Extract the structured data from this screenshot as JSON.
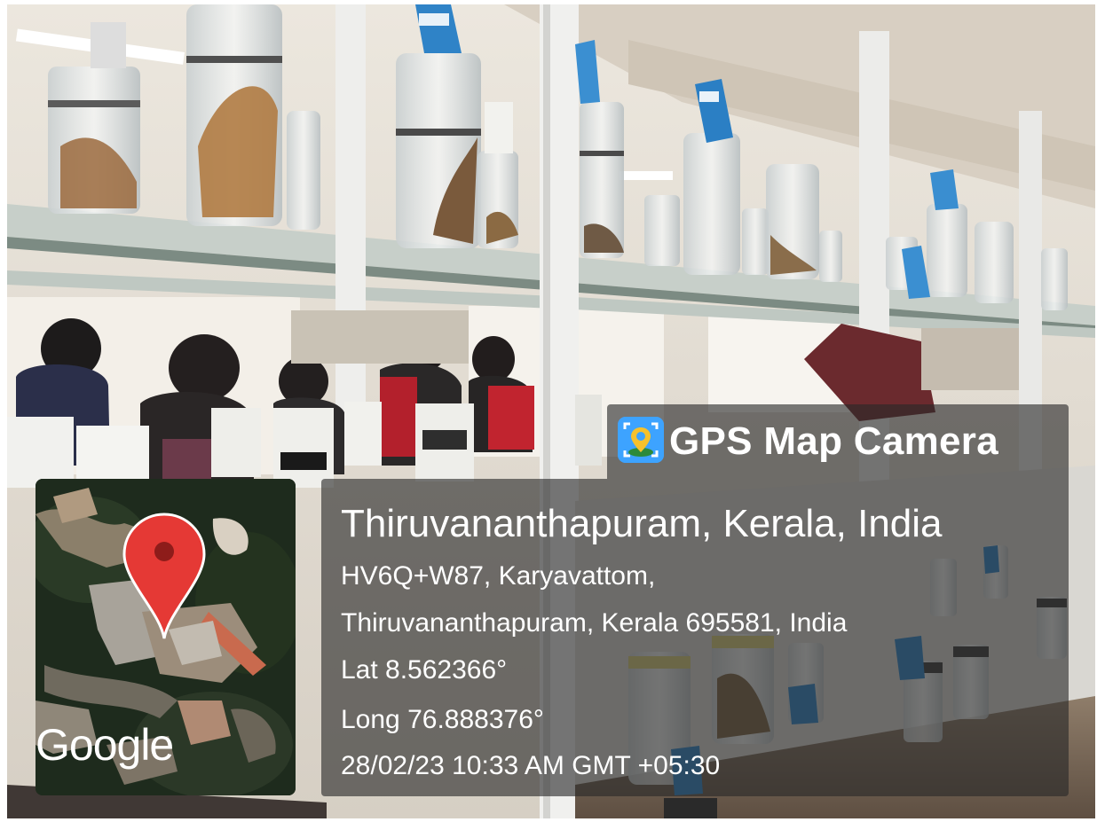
{
  "overlay": {
    "app_name": "GPS Map Camera",
    "location_title": "Thiruvananthapuram, Kerala, India",
    "address_line1": "HV6Q+W87, Karyavattom,",
    "address_line2": "Thiruvananthapuram, Kerala 695581, India",
    "latitude": "Lat 8.562366°",
    "longitude": "Long 76.888376°",
    "datetime": "28/02/23 10:33 AM GMT +05:30",
    "map_attribution": "Google",
    "app_icon": "camera-location-icon",
    "map_marker_icon": "map-pin-icon",
    "colors": {
      "panel": "rgba(40,40,40,0.62)",
      "pin": "#e53935",
      "app_icon_bg": "#3da3ff",
      "text": "#ffffff"
    }
  }
}
